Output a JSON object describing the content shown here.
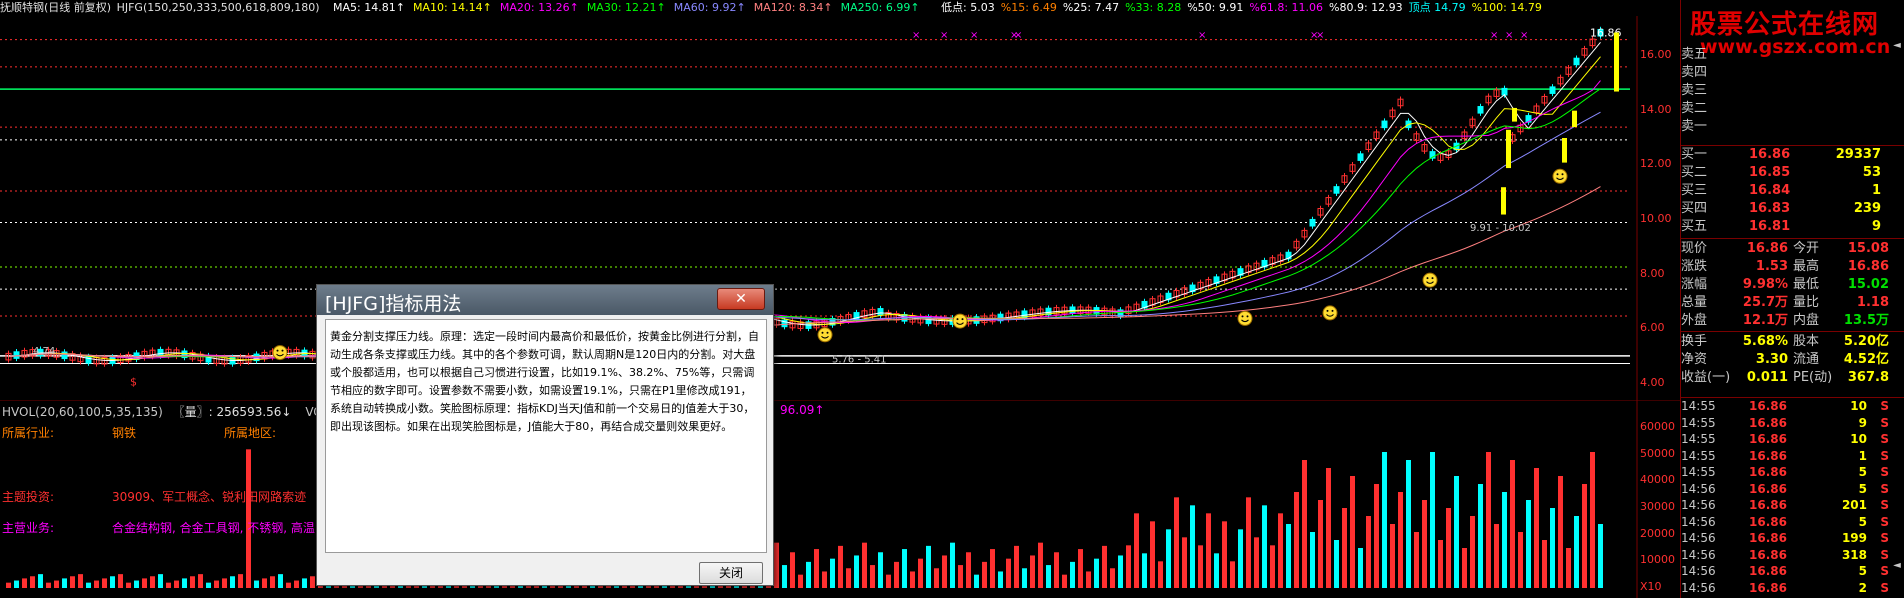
{
  "header": {
    "stock_name": "抚顺特钢(日线 前复权)",
    "indicator": "HJFG(150,250,333,500,618,809,180)",
    "ma": [
      {
        "label": "MA5:",
        "value": "14.81",
        "color": "#ffffff"
      },
      {
        "label": "MA10:",
        "value": "14.14",
        "color": "#ffff00"
      },
      {
        "label": "MA20:",
        "value": "13.26",
        "color": "#ff00ff"
      },
      {
        "label": "MA30:",
        "value": "12.21",
        "color": "#00ff00"
      },
      {
        "label": "MA60:",
        "value": "9.92",
        "color": "#8888ff"
      },
      {
        "label": "MA120:",
        "value": "8.34",
        "color": "#ff8080"
      },
      {
        "label": "MA250:",
        "value": "6.99",
        "color": "#00ff88"
      }
    ],
    "levels": [
      {
        "label": "低点:",
        "value": "5.03",
        "color": "#ffffff"
      },
      {
        "label": "%15:",
        "value": "6.49",
        "color": "#ff8000"
      },
      {
        "label": "%25:",
        "value": "7.47",
        "color": "#ffffff"
      },
      {
        "label": "%33:",
        "value": "8.28",
        "color": "#00ff00"
      },
      {
        "label": "%50:",
        "value": "9.91",
        "color": "#ffffff"
      },
      {
        "label": "%61.8:",
        "value": "11.06",
        "color": "#ff00ff"
      },
      {
        "label": "%80.9:",
        "value": "12.93",
        "color": "#ffffff"
      },
      {
        "label": "顶点",
        "value": "14.79",
        "color": "#00ffff"
      },
      {
        "label": "%100:",
        "value": "14.79",
        "color": "#ffff00"
      }
    ]
  },
  "chart_annotations": {
    "peak_label": "16.86",
    "range_label_1": "9.91 - 10.02",
    "range_label_2": "5.76 - 5.41",
    "left_label": "4.74",
    "low_label": "4.74",
    "marker": "$"
  },
  "price_axis": [
    "16.00",
    "14.00",
    "12.00",
    "10.00",
    "8.00",
    "6.00",
    "4.00"
  ],
  "volume_axis": [
    "60000",
    "50000",
    "40000",
    "30000",
    "20000",
    "10000",
    "X10"
  ],
  "volume_header": {
    "left": "HVOL(20,60,100,5,35,135)",
    "mid": "〖量〗: 256593.56↓",
    "vol_label": "VOLUME",
    "right": "96.09↑"
  },
  "info": {
    "industry_label": "所属行业:",
    "industry": "钢铁",
    "region_label": "所属地区:",
    "theme_label": "主题投资:",
    "theme": "30909、军工概念、锐利田网路索迹",
    "business_label": "主营业务:",
    "business": "合金结构钢, 合金工具钢, 不锈钢, 高温"
  },
  "dialog": {
    "title": "[HJFG]指标用法",
    "close_x": "✕",
    "body": "黄金分割支撑压力线。原理：选定一段时间内最高价和最低价，按黄金比例进行分割，自动生成各条支撑或压力线。其中的各个参数可调，默认周期N是120日内的分割。对大盘或个股都适用，也可以根据自己习惯进行设置，比如19.1%、38.2%、75%等，只需调节相应的数字即可。设置参数不需要小数，如需设置19.1%，只需在P1里修改成191，系统自动转换成小数。笑脸图标原理：指标KDJ当天J值和前一个交易日的J值差大于30，即出现该图标。如果在出现笑脸图标是，J值能大于80，再结合成交量则效果更好。",
    "ok": "关闭"
  },
  "logo": {
    "line1": "股票公式在线网",
    "line2": "www.gszx.com.cn"
  },
  "order_book": {
    "sell": [
      {
        "label": "卖五",
        "price": "",
        "vol": ""
      },
      {
        "label": "卖四",
        "price": "",
        "vol": ""
      },
      {
        "label": "卖三",
        "price": "",
        "vol": ""
      },
      {
        "label": "卖二",
        "price": "",
        "vol": ""
      },
      {
        "label": "卖一",
        "price": "",
        "vol": ""
      }
    ],
    "buy": [
      {
        "label": "买一",
        "price": "16.86",
        "vol": "29337"
      },
      {
        "label": "买二",
        "price": "16.85",
        "vol": "53"
      },
      {
        "label": "买三",
        "price": "16.84",
        "vol": "1"
      },
      {
        "label": "买四",
        "price": "16.83",
        "vol": "239"
      },
      {
        "label": "买五",
        "price": "16.81",
        "vol": "9"
      }
    ]
  },
  "quote": [
    {
      "k1": "现价",
      "v1": "16.86",
      "k2": "今开",
      "v2": "15.08",
      "c2": "#ff3030"
    },
    {
      "k1": "涨跌",
      "v1": "1.53",
      "k2": "最高",
      "v2": "16.86",
      "c2": "#ff3030"
    },
    {
      "k1": "涨幅",
      "v1": "9.98%",
      "k2": "最低",
      "v2": "15.02",
      "c2": "#00e000"
    },
    {
      "k1": "总量",
      "v1": "25.7万",
      "k2": "量比",
      "v2": "1.18",
      "c2": "#ff3030"
    },
    {
      "k1": "外盘",
      "v1": "12.1万",
      "k2": "内盘",
      "v2": "13.5万",
      "c2": "#00e000"
    },
    {
      "k1": "换手",
      "v1": "5.68%",
      "k2": "股本",
      "v2": "5.20亿",
      "c2": "#ffff00"
    },
    {
      "k1": "净资",
      "v1": "3.30",
      "k2": "流通",
      "v2": "4.52亿",
      "c2": "#ffff00"
    },
    {
      "k1": "收益(一)",
      "v1": "0.011",
      "k2": "PE(动)",
      "v2": "367.8",
      "c2": "#ffff00"
    }
  ],
  "ticks": [
    {
      "time": "14:55",
      "price": "16.86",
      "vol": "10",
      "side": "S"
    },
    {
      "time": "14:55",
      "price": "16.86",
      "vol": "9",
      "side": "S"
    },
    {
      "time": "14:55",
      "price": "16.86",
      "vol": "10",
      "side": "S"
    },
    {
      "time": "14:55",
      "price": "16.86",
      "vol": "1",
      "side": "S"
    },
    {
      "time": "14:55",
      "price": "16.86",
      "vol": "5",
      "side": "S"
    },
    {
      "time": "14:56",
      "price": "16.86",
      "vol": "5",
      "side": "S"
    },
    {
      "time": "14:56",
      "price": "16.86",
      "vol": "201",
      "side": "S"
    },
    {
      "time": "14:56",
      "price": "16.86",
      "vol": "5",
      "side": "S"
    },
    {
      "time": "14:56",
      "price": "16.86",
      "vol": "199",
      "side": "S"
    },
    {
      "time": "14:56",
      "price": "16.86",
      "vol": "318",
      "side": "S"
    },
    {
      "time": "14:56",
      "price": "16.86",
      "vol": "5",
      "side": "S"
    },
    {
      "time": "14:56",
      "price": "16.86",
      "vol": "2",
      "side": "S"
    }
  ],
  "colors": {
    "up": "#ff3030",
    "down": "#00ffff",
    "axis": "#7a0000",
    "green_line": "#00ff66"
  }
}
